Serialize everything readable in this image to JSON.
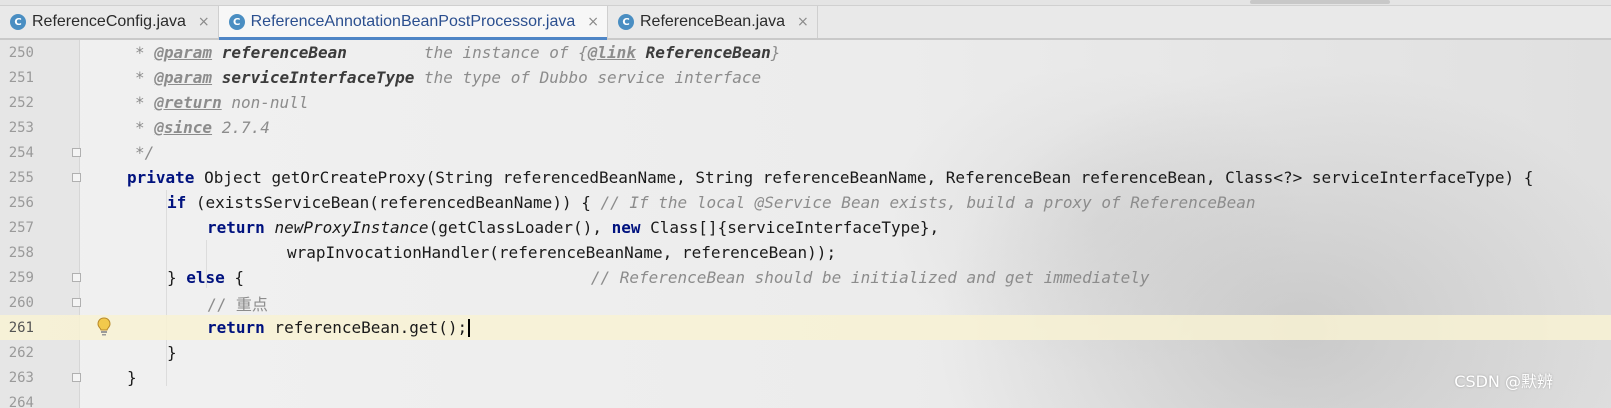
{
  "tabs": [
    {
      "icon": "C",
      "label": "ReferenceConfig.java",
      "close": "×"
    },
    {
      "icon": "C",
      "label": "ReferenceAnnotationBeanPostProcessor.java",
      "close": "×"
    },
    {
      "icon": "C",
      "label": "ReferenceBean.java",
      "close": "×"
    }
  ],
  "lines": [
    {
      "number": "250"
    },
    {
      "number": "251"
    },
    {
      "number": "252"
    },
    {
      "number": "253"
    },
    {
      "number": "254"
    },
    {
      "number": "255"
    },
    {
      "number": "256"
    },
    {
      "number": "257"
    },
    {
      "number": "258"
    },
    {
      "number": "259"
    },
    {
      "number": "260"
    },
    {
      "number": "261"
    },
    {
      "number": "262"
    },
    {
      "number": "263"
    },
    {
      "number": "264"
    }
  ],
  "code": {
    "l250": {
      "star": "* ",
      "tag": "@param",
      "name": "referenceBean",
      "pad": "        ",
      "desc": "the instance of {",
      "link": "@link",
      "type": " ReferenceBean",
      "end": "}"
    },
    "l251": {
      "star": "* ",
      "tag": "@param",
      "name": "serviceInterfaceType",
      "desc": " the type of Dubbo service interface"
    },
    "l252": {
      "star": "* ",
      "tag": "@return",
      "desc": " non-null"
    },
    "l253": {
      "star": "* ",
      "tag": "@since",
      "desc": " 2.7.4"
    },
    "l254": {
      "text": "*/"
    },
    "l255": {
      "kw": "private",
      "rest": " Object getOrCreateProxy(String referencedBeanName, String referenceBeanName, ReferenceBean referenceBean, Class<?> serviceInterfaceType) {"
    },
    "l256": {
      "kw": "if",
      "rest": " (existsServiceBean(referencedBeanName)) { ",
      "comment": "// If the local @Service Bean exists, build a proxy of ReferenceBean"
    },
    "l257": {
      "kw": "return",
      "method": "newProxyInstance",
      "mid": "(getClassLoader(), ",
      "kw2": "new",
      "rest": " Class[]{serviceInterfaceType},"
    },
    "l258": {
      "text": "wrapInvocationHandler(referenceBeanName, referenceBean));"
    },
    "l259": {
      "brace": "} ",
      "kw": "else",
      "rest": " {",
      "pad": "                                    ",
      "comment": "// ReferenceBean should be initialized and get immediately"
    },
    "l260": {
      "comment": "// 重点"
    },
    "l261": {
      "kw": "return",
      "rest": " referenceBean.get();"
    },
    "l262": {
      "text": "}"
    },
    "l263": {
      "text": "}"
    },
    "l264": {
      "text": ""
    }
  },
  "watermark": "CSDN @默辨",
  "colors": {
    "keyword": "#00127f",
    "comment": "#8c8c8c",
    "current_line": "#f8f2d4",
    "tab_accent": "#4f86c6"
  }
}
